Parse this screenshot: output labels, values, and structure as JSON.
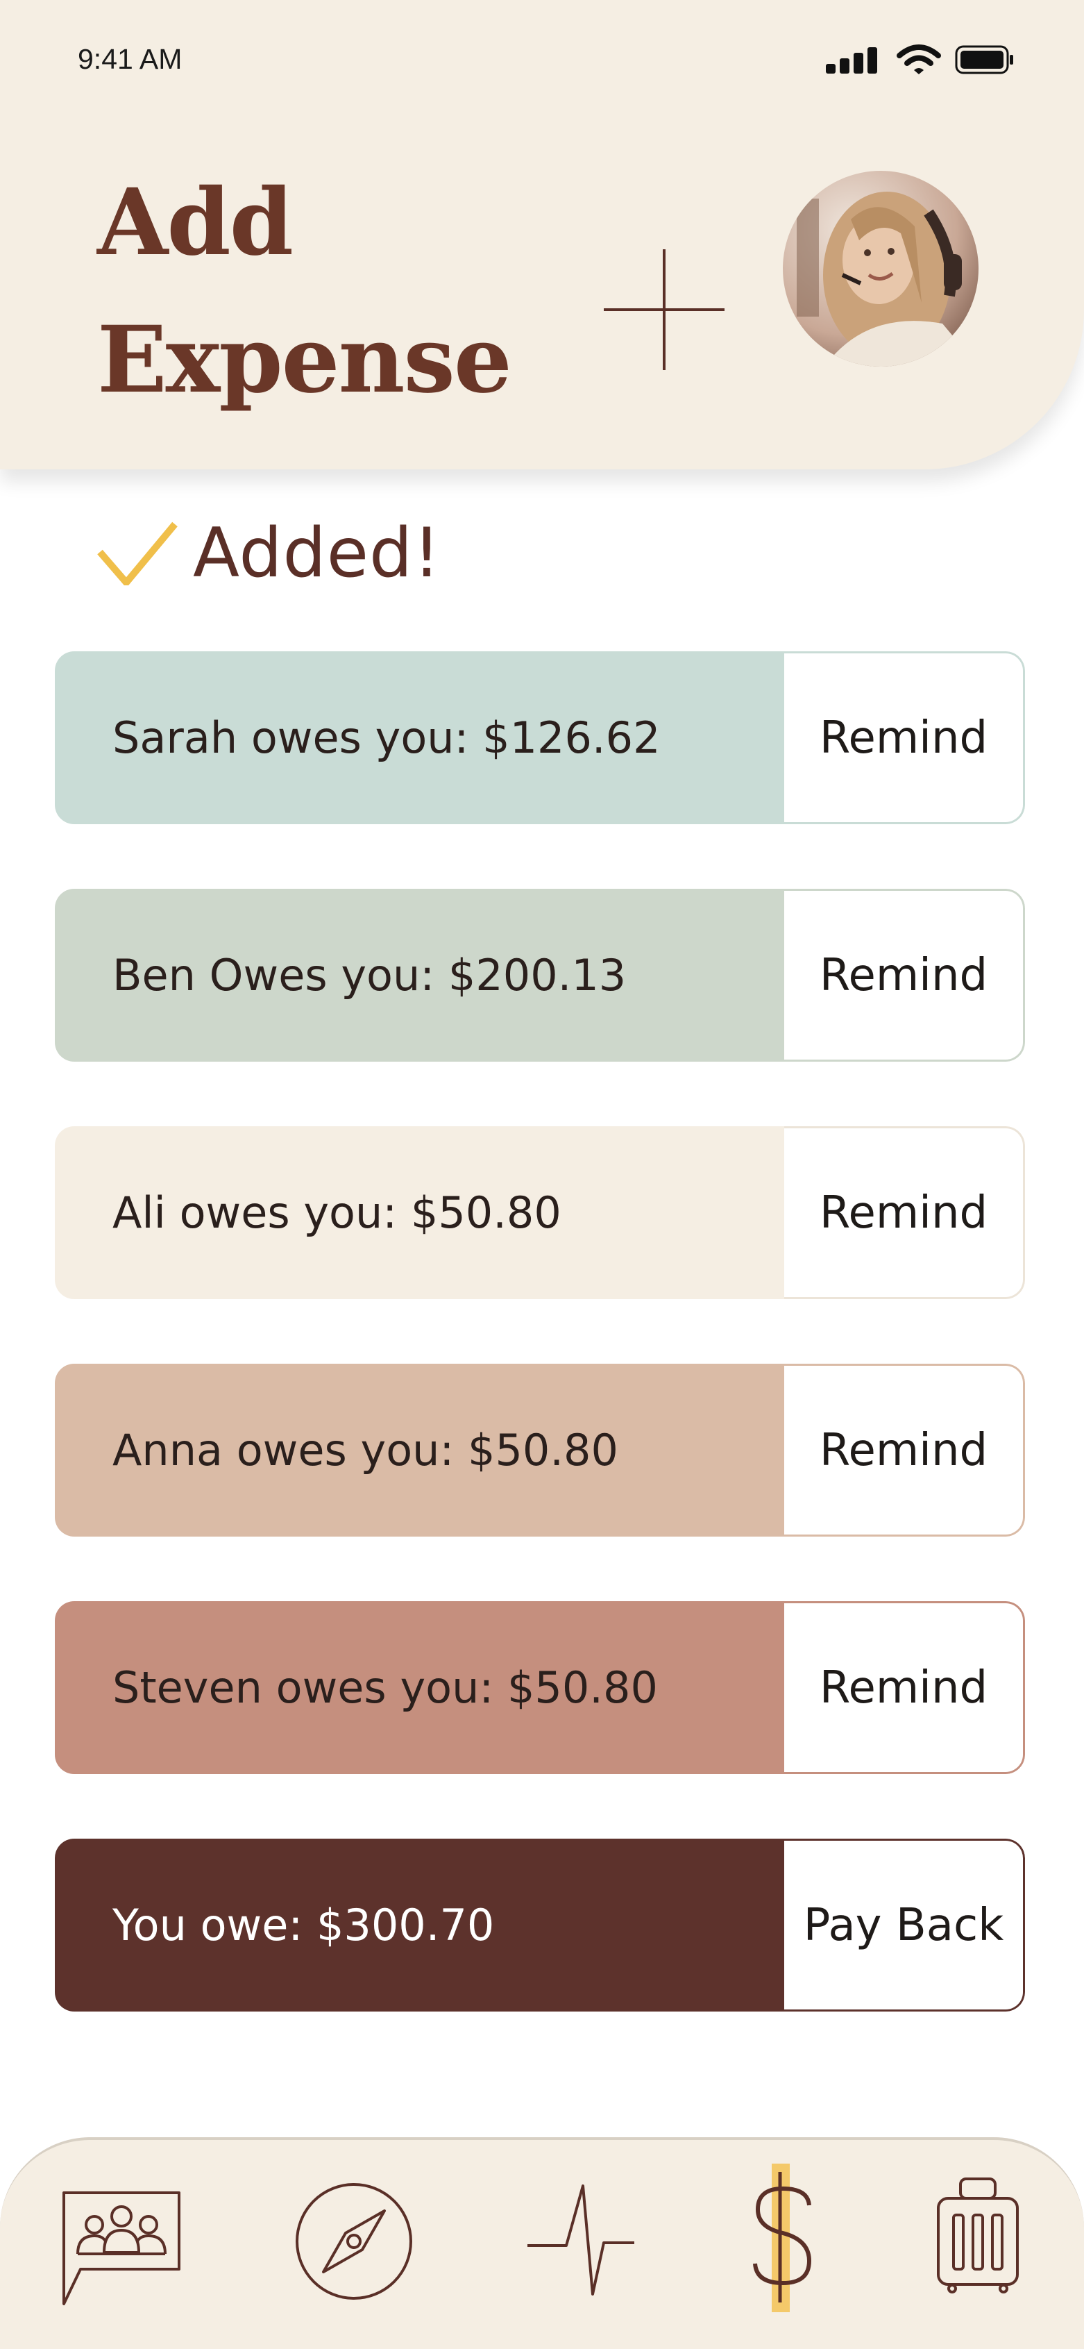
{
  "status_bar": {
    "time": "9:41 AM"
  },
  "header": {
    "title_line1": "Add",
    "title_line2": "Expense",
    "add_icon": "plus-icon",
    "avatar": "profile-avatar"
  },
  "confirmation": {
    "icon": "check-icon",
    "text": "Added!"
  },
  "balances": [
    {
      "text": "Sarah owes you: $126.62",
      "action": "Remind",
      "bg": "#c9dcd6",
      "border": "#c9dcd6"
    },
    {
      "text": "Ben Owes you: $200.13",
      "action": "Remind",
      "bg": "#cdd7cb",
      "border": "#cdd7cb"
    },
    {
      "text": "Ali owes you: $50.80",
      "action": "Remind",
      "bg": "#f5eee3",
      "border": "#ece4d8"
    },
    {
      "text": "Anna owes you: $50.80",
      "action": "Remind",
      "bg": "#dabba6",
      "border": "#dabba6"
    },
    {
      "text": "Steven owes you: $50.80",
      "action": "Remind",
      "bg": "#c58f7e",
      "border": "#c58f7e"
    },
    {
      "text": "You owe: $300.70",
      "action": "Pay Back",
      "bg": "#5d322c",
      "border": "#5d322c"
    }
  ],
  "bottom_nav": {
    "items": [
      "group-chat-icon",
      "compass-icon",
      "activity-icon",
      "dollar-icon",
      "luggage-icon"
    ],
    "active": "dollar-icon",
    "accent": "#f4c96a",
    "icon_color": "#5a2f27"
  }
}
